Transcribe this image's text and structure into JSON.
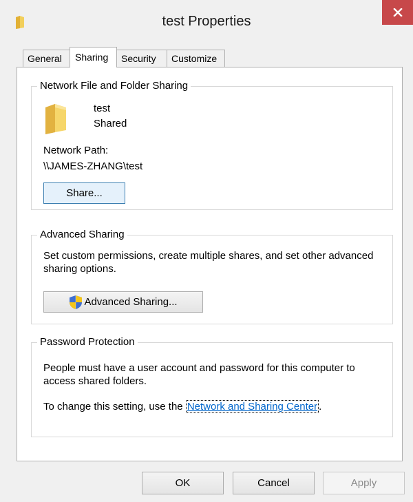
{
  "window": {
    "title": "test Properties",
    "title_icon": "folder-icon",
    "close_icon": "close-icon",
    "close_color": "#c7484a"
  },
  "tabs": [
    {
      "label": "General",
      "active": false
    },
    {
      "label": "Sharing",
      "active": true
    },
    {
      "label": "Security",
      "active": false
    },
    {
      "label": "Customize",
      "active": false
    }
  ],
  "network_sharing": {
    "group_label": "Network File and Folder Sharing",
    "folder_name": "test",
    "folder_status": "Shared",
    "path_label": "Network Path:",
    "path_value": "\\\\JAMES-ZHANG\\test",
    "share_button": "Share..."
  },
  "advanced_sharing": {
    "group_label": "Advanced Sharing",
    "description": "Set custom permissions, create multiple shares, and set other advanced sharing options.",
    "button": "Advanced Sharing...",
    "button_icon": "uac-shield-icon"
  },
  "password_protection": {
    "group_label": "Password Protection",
    "description": "People must have a user account and password for this computer to access shared folders.",
    "change_text": "To change this setting, use the ",
    "link_text": "Network and Sharing Center",
    "change_suffix": ".",
    "link_color": "#0066cc"
  },
  "buttons": {
    "ok": "OK",
    "cancel": "Cancel",
    "apply": "Apply"
  }
}
